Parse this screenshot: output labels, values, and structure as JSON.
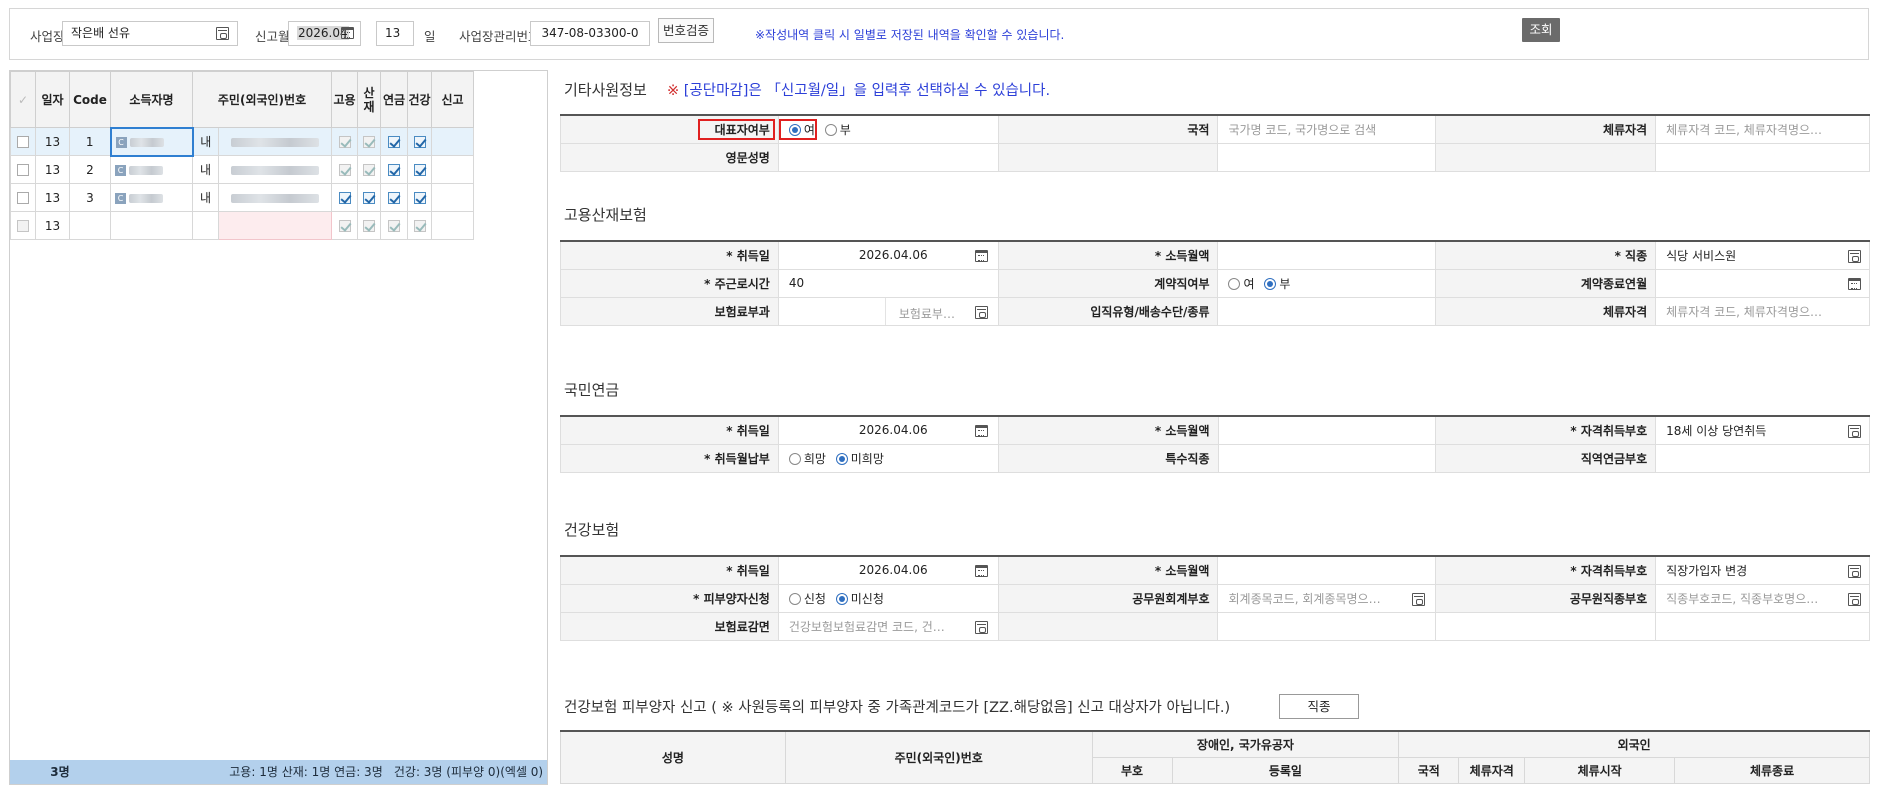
{
  "filter": {
    "workplace_label": "사업장",
    "workplace_value": "작은배 선유",
    "report_month_label": "신고월",
    "report_month_value": "2026.04",
    "day_value": "13",
    "day_unit": "일",
    "mgmt_no_label": "사업장관리번호",
    "mgmt_no_value": "347-08-03300-0",
    "verify_button": "번호검증",
    "notice": "※작성내역 클릭 시 일별로 저장된 내역을 확인할 수 있습니다.",
    "search_button": "조회"
  },
  "grid": {
    "headers": [
      "일자",
      "Code",
      "소득자명",
      "주민(외국인)번호",
      "고용",
      "산재",
      "연금",
      "건강",
      "신고"
    ],
    "rows": [
      {
        "day": "13",
        "code": "1",
        "type": "내",
        "ins": [
          true,
          true,
          true,
          true
        ],
        "ins_dim": [
          true,
          true,
          false,
          false
        ]
      },
      {
        "day": "13",
        "code": "2",
        "type": "내",
        "ins": [
          true,
          true,
          true,
          true
        ],
        "ins_dim": [
          true,
          true,
          false,
          false
        ]
      },
      {
        "day": "13",
        "code": "3",
        "type": "내",
        "ins": [
          true,
          true,
          true,
          true
        ],
        "ins_dim": [
          false,
          false,
          false,
          false
        ]
      },
      {
        "day": "13",
        "code": "",
        "type": "",
        "ins": [
          true,
          true,
          true,
          true
        ],
        "ins_dim": [
          true,
          true,
          true,
          true
        ]
      }
    ],
    "name_badge": "C",
    "footer": {
      "count": "3명",
      "summary": "고용: 1명 산재: 1명 연금: 3명",
      "health": "건강: 3명 (피부양 0)(엑셀 0)"
    }
  },
  "other": {
    "title": "기타사원정보",
    "warning_prefix": "※",
    "warning_text": "[공단마감]은 「신고월/일」을 입력후 선택하실 수 있습니다.",
    "rep_label": "대표자여부",
    "rep_yes": "여",
    "rep_no": "부",
    "nationality_label": "국적",
    "nationality_ph": "국가명 코드, 국가명으로 검색",
    "stay_label": "체류자격",
    "stay_ph": "체류자격 코드, 체류자격명으…",
    "eng_name_label": "영문성명"
  },
  "employment": {
    "title": "고용산재보험",
    "acq_date_label": "* 취득일",
    "acq_date_value": "2026.04.06",
    "income_label": "* 소득월액",
    "job_label": "* 직종",
    "job_value": "식당 서비스원",
    "weekly_hours_label": "* 주근로시간",
    "weekly_hours_value": "40",
    "contract_label": "계약직여부",
    "contract_yes": "여",
    "contract_no": "부",
    "contract_end_label": "계약종료연월",
    "premium_label": "보험료부과",
    "premium_ph": "보험료부…",
    "entry_type_label": "입직유형/배송수단/종류",
    "stay_label": "체류자격",
    "stay_ph": "체류자격 코드, 체류자격명으…"
  },
  "pension": {
    "title": "국민연금",
    "acq_date_label": "* 취득일",
    "acq_date_value": "2026.04.06",
    "income_label": "* 소득월액",
    "qual_label": "* 자격취득부호",
    "qual_value": "18세 이상 당연취득",
    "pay_label": "* 취득월납부",
    "pay_yes": "희망",
    "pay_no": "미희망",
    "special_job_label": "특수직종",
    "occ_pension_label": "직역연금부호"
  },
  "health": {
    "title": "건강보험",
    "acq_date_label": "* 취득일",
    "acq_date_value": "2026.04.06",
    "income_label": "* 소득월액",
    "qual_label": "* 자격취득부호",
    "qual_value": "직장가입자 변경",
    "dep_label": "* 피부양자신청",
    "dep_yes": "신청",
    "dep_no": "미신청",
    "acct_label": "공무원회계부호",
    "acct_ph": "회계종목코드, 회계종목명으…",
    "rank_label": "공무원직종부호",
    "rank_ph": "직종부호코드, 직종부호명으…",
    "reduce_label": "보험료감면",
    "reduce_ph": "건강보험보험료감면 코드, 건…"
  },
  "dependent": {
    "title": "건강보험 피부양자 신고 ( ※ 사원등록의 피부양자 중 가족관계코드가 [ZZ.해당없음] 신고 대상자가 아닙니다.)",
    "button": "직종",
    "headers": {
      "name": "성명",
      "id": "주민(외국인)번호",
      "disabled": "장애인, 국가유공자",
      "code": "부호",
      "reg_date": "등록일",
      "foreigner": "외국인",
      "nationality": "국적",
      "stay": "체류자격",
      "stay_start": "체류시작",
      "stay_end": "체류종료"
    }
  }
}
